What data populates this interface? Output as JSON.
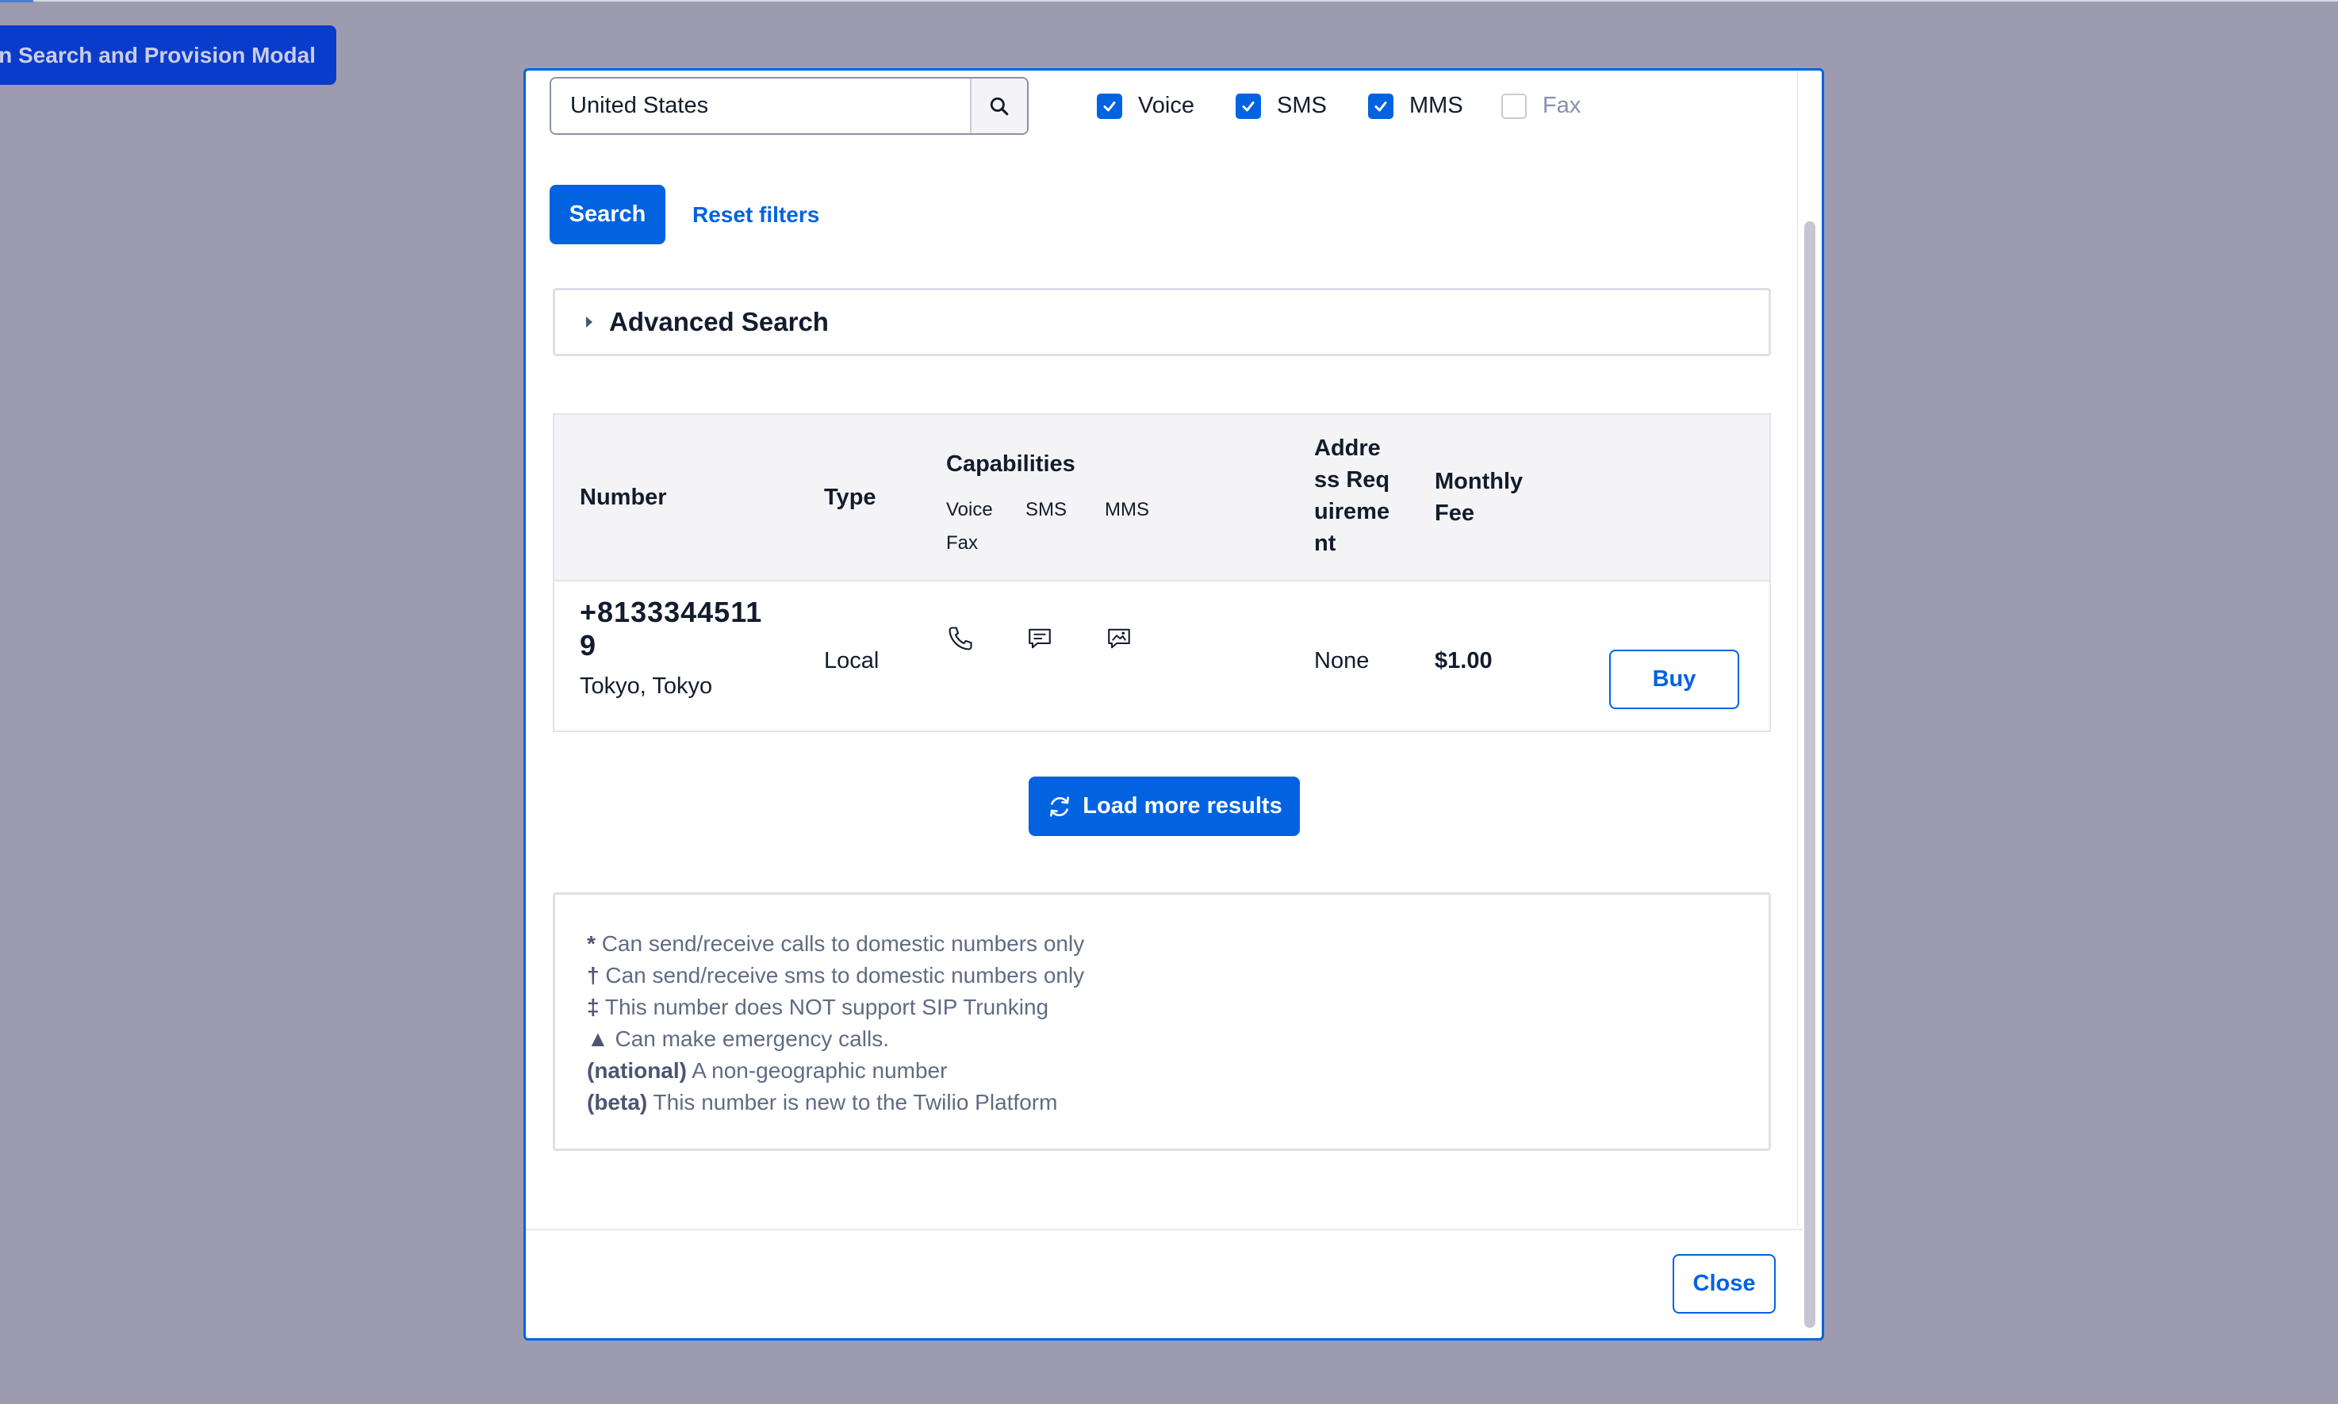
{
  "background_button": {
    "label": "n Search and Provision Modal"
  },
  "filters": {
    "country_value": "United States",
    "capabilities": [
      {
        "label": "Voice",
        "checked": true
      },
      {
        "label": "SMS",
        "checked": true
      },
      {
        "label": "MMS",
        "checked": true
      },
      {
        "label": "Fax",
        "checked": false
      }
    ],
    "search_label": "Search",
    "reset_label": "Reset filters"
  },
  "advanced_search": {
    "label": "Advanced Search"
  },
  "table": {
    "headers": {
      "number": "Number",
      "type": "Type",
      "capabilities": "Capabilities",
      "cap_voice": "Voice",
      "cap_sms": "SMS",
      "cap_mms": "MMS",
      "cap_fax": "Fax",
      "address_requirement": "Address Requirement",
      "monthly_fee": "Monthly Fee"
    },
    "rows": [
      {
        "number": "+81333445119",
        "location": "Tokyo, Tokyo",
        "type": "Local",
        "capability_icons": [
          "phone-icon",
          "sms-icon",
          "mms-icon"
        ],
        "address_requirement": "None",
        "monthly_fee": "$1.00",
        "buy_label": "Buy"
      }
    ]
  },
  "load_more": {
    "label": "Load more results",
    "icon": "refresh-icon"
  },
  "legend": [
    {
      "symbol": "*",
      "text": "Can send/receive calls to domestic numbers only"
    },
    {
      "symbol": "†",
      "text": "Can send/receive sms to domestic numbers only"
    },
    {
      "symbol": "‡",
      "text": "This number does NOT support SIP Trunking"
    },
    {
      "symbol": "▲",
      "text": "Can make emergency calls."
    },
    {
      "symbol": "(national)",
      "text": "A non-geographic number"
    },
    {
      "symbol": "(beta)",
      "text": "This number is new to the Twilio Platform"
    }
  ],
  "footer": {
    "close_label": "Close"
  },
  "colors": {
    "accent": "#0263e0",
    "overlay": "#9c9bb0",
    "text": "#121c2d",
    "muted": "#606b85"
  }
}
